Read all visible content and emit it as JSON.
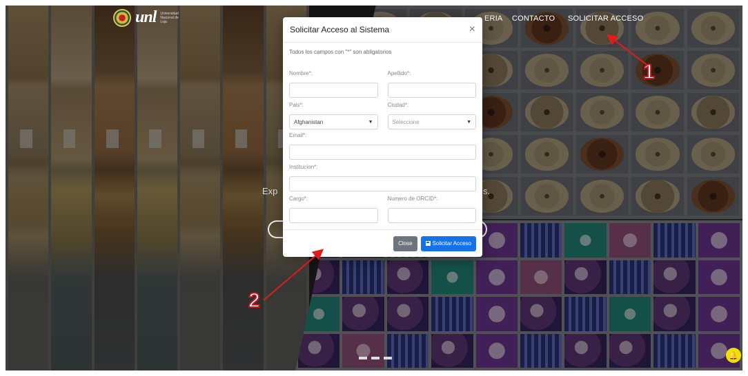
{
  "brand": {
    "logo_text": "unl",
    "logo_subtitle": "Universidad Nacional de Loja"
  },
  "nav": {
    "items": [
      "ERIA",
      "CONTACTO",
      "SOLICITAR ACCESO"
    ]
  },
  "hero": {
    "text_left": "Exp",
    "text_right": "s."
  },
  "modal": {
    "title": "Solicitar Acceso al Sistema",
    "close_icon": "×",
    "note": "Todos los campos con \"*\" son abligatorios",
    "fields": {
      "nombre": {
        "label": "Nombre*:",
        "value": ""
      },
      "apellido": {
        "label": "Apellido*:",
        "value": ""
      },
      "pais": {
        "label": "Pais*:",
        "value": "Afghanistan"
      },
      "ciudad": {
        "label": "Ciudad*:",
        "value": "Seleccione"
      },
      "email": {
        "label": "Email*:",
        "value": ""
      },
      "institucion": {
        "label": "Institucion*:",
        "value": ""
      },
      "cargo": {
        "label": "Cargo*:",
        "value": ""
      },
      "orcid": {
        "label": "Numero de ORCID*:",
        "value": ""
      }
    },
    "buttons": {
      "close": "Close",
      "submit": "Solicitar Acceso"
    }
  },
  "annotations": {
    "one": "1",
    "two": "2"
  },
  "colors": {
    "primary": "#1672e8",
    "secondary": "#6c757d",
    "annotation": "#e01b1b",
    "notification": "#f0e000"
  },
  "icons": {
    "close": "close-icon",
    "submit": "save-icon",
    "notification": "bell-icon"
  }
}
